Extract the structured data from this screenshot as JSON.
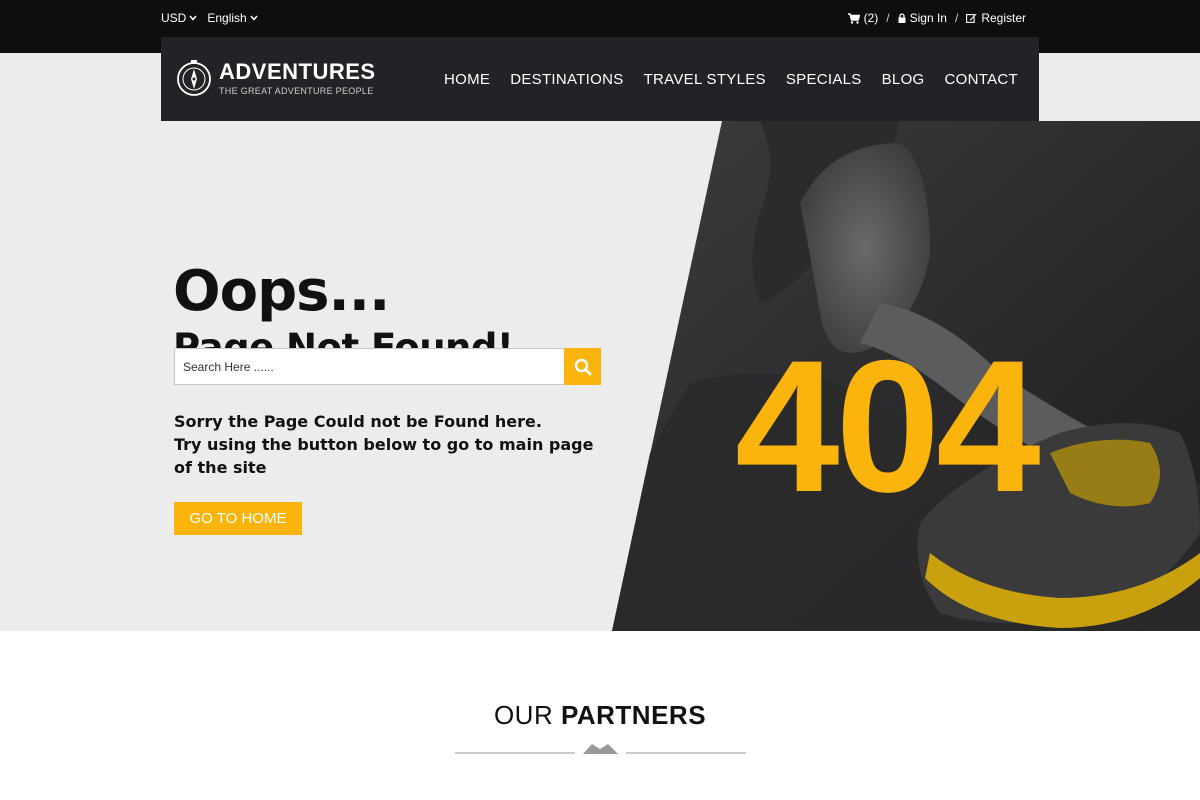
{
  "topbar": {
    "currency": "USD",
    "language": "English",
    "cart_count": "(2)",
    "separator": "/",
    "sign_in": "Sign In",
    "register": "Register"
  },
  "brand": {
    "name": "ADVENTURES",
    "tagline": "THE GREAT ADVENTURE PEOPLE"
  },
  "nav": {
    "items": [
      "HOME",
      "DESTINATIONS",
      "TRAVEL STYLES",
      "SPECIALS",
      "BLOG",
      "CONTACT"
    ]
  },
  "error": {
    "headline": "Oops...",
    "subheadline": "Page Not Found!",
    "code": "404",
    "message_lines": [
      "Sorry the Page Could not be Found here.",
      "Try using the button below to go to main page",
      "of the site"
    ],
    "button_label": "GO TO HOME"
  },
  "search": {
    "placeholder": "Search Here ......"
  },
  "partners": {
    "prefix": "OUR",
    "title": "PARTNERS"
  },
  "colors": {
    "accent": "#fbb40c",
    "topbar": "#0d0e10",
    "navbar": "#222326",
    "hero_bg": "#edeced"
  }
}
